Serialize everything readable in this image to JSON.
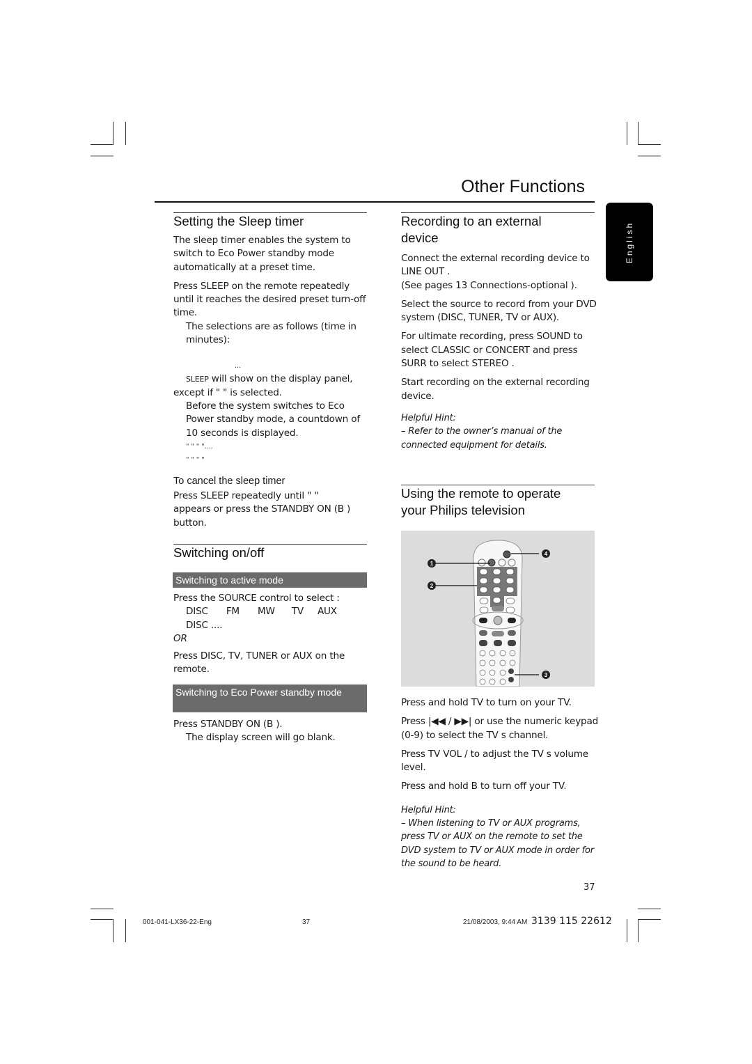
{
  "header": {
    "title": "Other Functions"
  },
  "side_tab": {
    "label": "English"
  },
  "left": {
    "sleep": {
      "heading": "Setting the Sleep timer",
      "intro": "The sleep timer enables the system to switch to Eco Power standby mode automatically at a preset time.",
      "step1": "Press SLEEP on the remote repeatedly until it reaches the desired preset turn-off time.",
      "step1_note": "The selections are as follows (time in minutes):",
      "selections_dots": "...",
      "sleep_label": "SLEEP",
      "display_note_rest": " will show on the display panel,",
      "display_note_line2": "except if \"      \" is selected.",
      "countdown": "Before the system switches to Eco Power standby mode, a countdown of 10 seconds is displayed.",
      "quote_line1": "\"                    \"  \"                 \"....",
      "quote_line2": "\"                 \"  \"            \"",
      "cancel_heading": "To cancel the sleep timer",
      "cancel_text": "Press SLEEP repeatedly until \"       \" appears or press the STANDBY ON (B ) button."
    },
    "switching": {
      "heading": "Switching on/off",
      "active_bar": "Switching to active mode",
      "source_line": "Press the SOURCE control to select :",
      "source_sequence": [
        "DISC",
        "FM",
        "MW",
        "TV",
        "AUX"
      ],
      "source_loop": "DISC ....",
      "or": "OR",
      "remote_line": "Press DISC, TV, TUNER or AUX on the remote.",
      "eco_bar": "Switching to Eco Power standby mode",
      "standby_line": "Press STANDBY ON   (B ).",
      "standby_note": "The display screen will go blank."
    }
  },
  "right": {
    "recording": {
      "heading": "Recording to an external device",
      "p1": "Connect the external recording device to LINE OUT  .",
      "p1b": "(See pages 13  Connections-optional  ).",
      "p2": "Select the source to record from your DVD system (DISC, TUNER, TV or AUX).",
      "p3": "For ultimate recording, press SOUND to select CLASSIC  or CONCERT  and press SURR to select STEREO .",
      "p4": "Start recording on the external recording device.",
      "hint_title": "Helpful Hint:",
      "hint_text": "– Refer to the owner’s manual of the connected equipment for details."
    },
    "tv": {
      "heading": "Using the remote to operate your  Philips  television",
      "callouts": [
        "1",
        "2",
        "3",
        "4"
      ],
      "p1": "Press and hold TV  to turn on your TV.",
      "p2": "Press |◀◀ / ▶▶| or use the numeric keypad (0-9)  to select the TV s channel.",
      "p3": "Press TV VOL       /      to adjust the TV s volume level.",
      "p4": "Press and hold B   to turn off your TV.",
      "hint_title": "Helpful Hint:",
      "hint_text": "– When listening to TV or AUX programs, press TV or AUX on the remote to set the DVD system to TV or AUX mode in order for the sound to be heard."
    }
  },
  "page_number": "37",
  "footer": {
    "file": "001-041-LX36-22-Eng",
    "page": "37",
    "timestamp": "21/08/2003, 9:44 AM",
    "code": "3139 115 22612"
  }
}
